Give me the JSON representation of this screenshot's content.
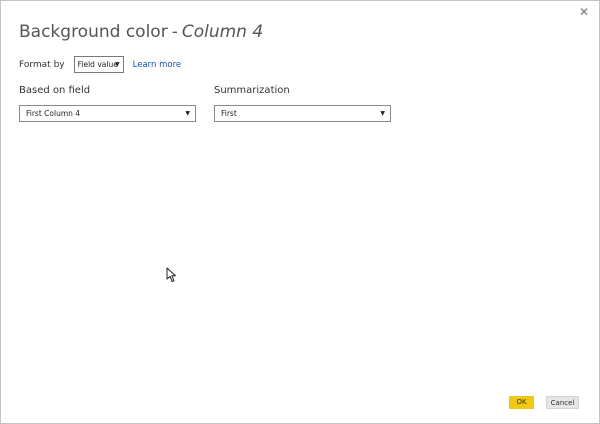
{
  "dialog": {
    "title_prefix": "Background color",
    "title_separator": "-",
    "title_column": "Column 4",
    "close_icon": "close-icon"
  },
  "format": {
    "label": "Format by",
    "selected": "Field value",
    "learn_more": "Learn more"
  },
  "based_on": {
    "label": "Based on field",
    "selected": "First Column 4"
  },
  "summarization": {
    "label": "Summarization",
    "selected": "First"
  },
  "buttons": {
    "ok": "OK",
    "cancel": "Cancel"
  },
  "colors": {
    "ok_accent": "#f2c811",
    "link": "#1a52c4"
  }
}
